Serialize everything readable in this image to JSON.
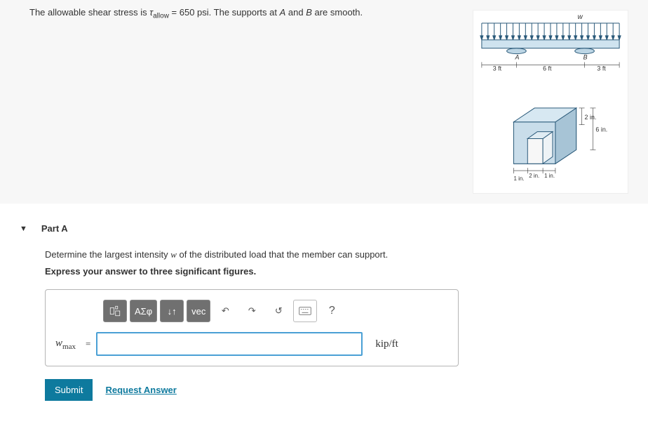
{
  "problem": {
    "prefix": "The allowable shear stress is ",
    "tau_sym": "τ",
    "tau_sub": "allow",
    "eq": " = ",
    "value": "650 psi",
    "suffix1": ". The supports at ",
    "A": "A",
    "and": " and ",
    "B": "B",
    "suffix2": " are smooth."
  },
  "figure": {
    "w": "w",
    "A": "A",
    "B": "B",
    "dim_3ft_l": "3 ft",
    "dim_6ft": "6 ft",
    "dim_3ft_r": "3 ft",
    "dim_2in": "2 in.",
    "dim_6in": "6 in.",
    "dim_1in_l": "1 in.",
    "dim_2in_b": "2 in.",
    "dim_1in_r": "1 in."
  },
  "part": {
    "title": "Part A",
    "question": "Determine the largest intensity w of the distributed load that the member can support.",
    "instruction": "Express your answer to three significant figures."
  },
  "toolbar": {
    "greek": "ΑΣφ",
    "updown": "↓↑",
    "vec": "vec",
    "undo": "↶",
    "redo": "↷",
    "reset": "↺",
    "help": "?"
  },
  "answer": {
    "var": "w",
    "var_sub": "max",
    "eq": "=",
    "value": "",
    "unit": "kip/ft"
  },
  "actions": {
    "submit": "Submit",
    "request": "Request Answer"
  }
}
